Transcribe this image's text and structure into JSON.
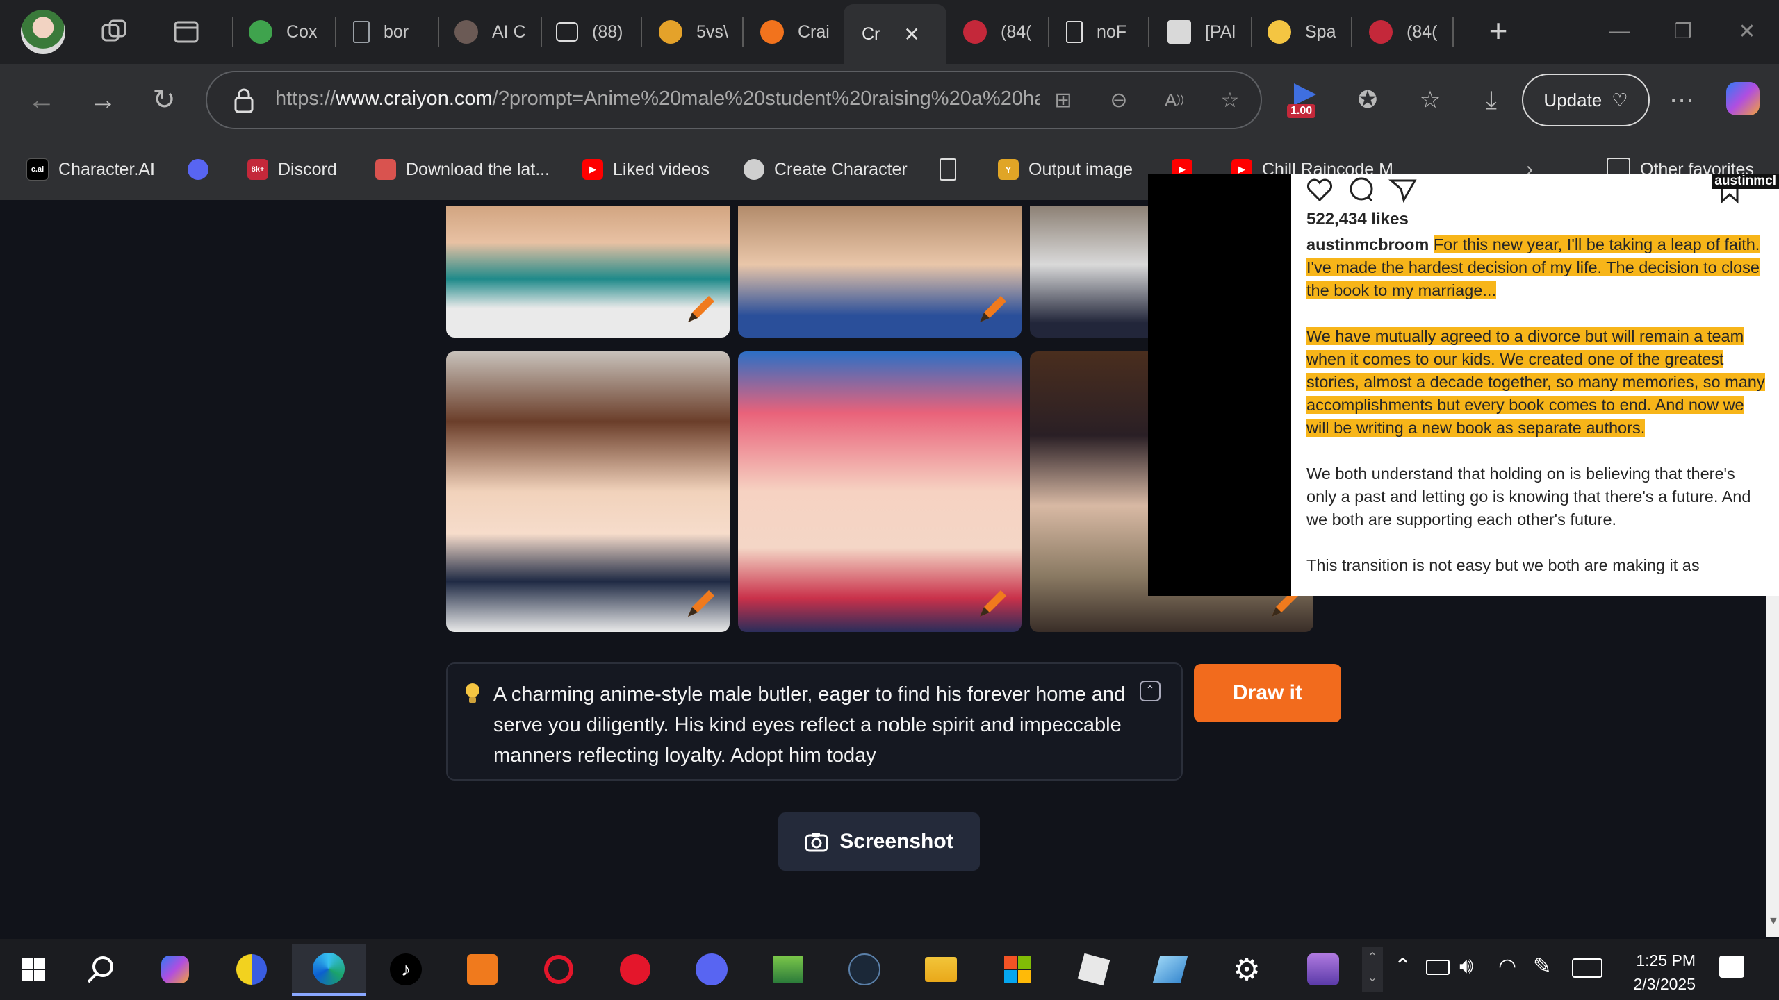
{
  "tabs": [
    {
      "title": "Cox",
      "color": "#3fa34d"
    },
    {
      "title": "bor",
      "color": "#9aa0a6"
    },
    {
      "title": "AI C",
      "color": "#6b5a55"
    },
    {
      "title": "(88)",
      "color": "#cfcfcf"
    },
    {
      "title": "5vs\\",
      "color": "#e4a22a"
    },
    {
      "title": "Crai",
      "color": "#f2731d"
    },
    {
      "title": "Cr",
      "color": "#2f3033"
    },
    {
      "title": "(84(",
      "color": "#c4283a"
    },
    {
      "title": "noF",
      "color": "#9aa0a6"
    },
    {
      "title": "[PAl",
      "color": "#d9d9d9"
    },
    {
      "title": "Spa",
      "color": "#f4c542"
    },
    {
      "title": "(84(",
      "color": "#c4283a"
    }
  ],
  "active_tab_index": 6,
  "close_glyph": "✕",
  "new_tab_glyph": "+",
  "address": {
    "scheme": "https://",
    "domain": "www.craiyon.com",
    "path": "/?prompt=Anime%20male%20student%20raising%20a%20ha..."
  },
  "rewards_badge": "1.00",
  "update_label": "Update",
  "bookmarks": [
    {
      "label": "Character.AI",
      "icon_text": "c.ai",
      "color": "#000000"
    },
    {
      "label": "",
      "icon_text": "",
      "color": "#5865f2"
    },
    {
      "label": "Discord",
      "icon_text": "8k+",
      "color": "#c4283a"
    },
    {
      "label": "Download the lat...",
      "icon_text": "",
      "color": "#d9534f"
    },
    {
      "label": "Liked videos",
      "icon_text": "▶",
      "color": "#ff0000"
    },
    {
      "label": "Create Character",
      "icon_text": "",
      "color": "#cfcfcf"
    },
    {
      "label": "",
      "icon_text": "",
      "color": "#2f3033"
    },
    {
      "label": "Output image",
      "icon_text": "Y",
      "color": "#e0a526"
    },
    {
      "label": "",
      "icon_text": "▶",
      "color": "#ff0000"
    },
    {
      "label": "Chill Raincode M",
      "icon_text": "▶",
      "color": "#ff0000"
    },
    {
      "label": "Other favorites",
      "icon_text": "",
      "color": "#2f3033"
    }
  ],
  "prompt": {
    "text": "A charming anime-style male butler, eager to find his forever home and serve you diligently. His kind eyes reflect a noble spirit and impeccable manners reflecting loyalty. Adopt him today"
  },
  "draw_button": "Draw it",
  "screenshot_button": "Screenshot",
  "overlay": {
    "likes": "522,434 likes",
    "username": "austinmcbroom",
    "username_top": "austinmcl",
    "para1": "For this new year, I'll be taking a leap of faith. I've made the hardest decision of my life. The decision to close the book to my marriage...",
    "para2": "We have mutually agreed to a divorce but will remain a team when it comes to our kids. We created one of the greatest stories, almost a decade together, so many memories, so many accomplishments but every book comes to end. And now we will be writing a new book as separate authors.",
    "para3": "We both understand that holding on is believing that there's only a past and letting go is knowing that there's a future. And we both are supporting each other's future.",
    "para4": "This transition is not easy but we both are making it as"
  },
  "clock": {
    "time": "1:25 PM",
    "date": "2/3/2025"
  }
}
